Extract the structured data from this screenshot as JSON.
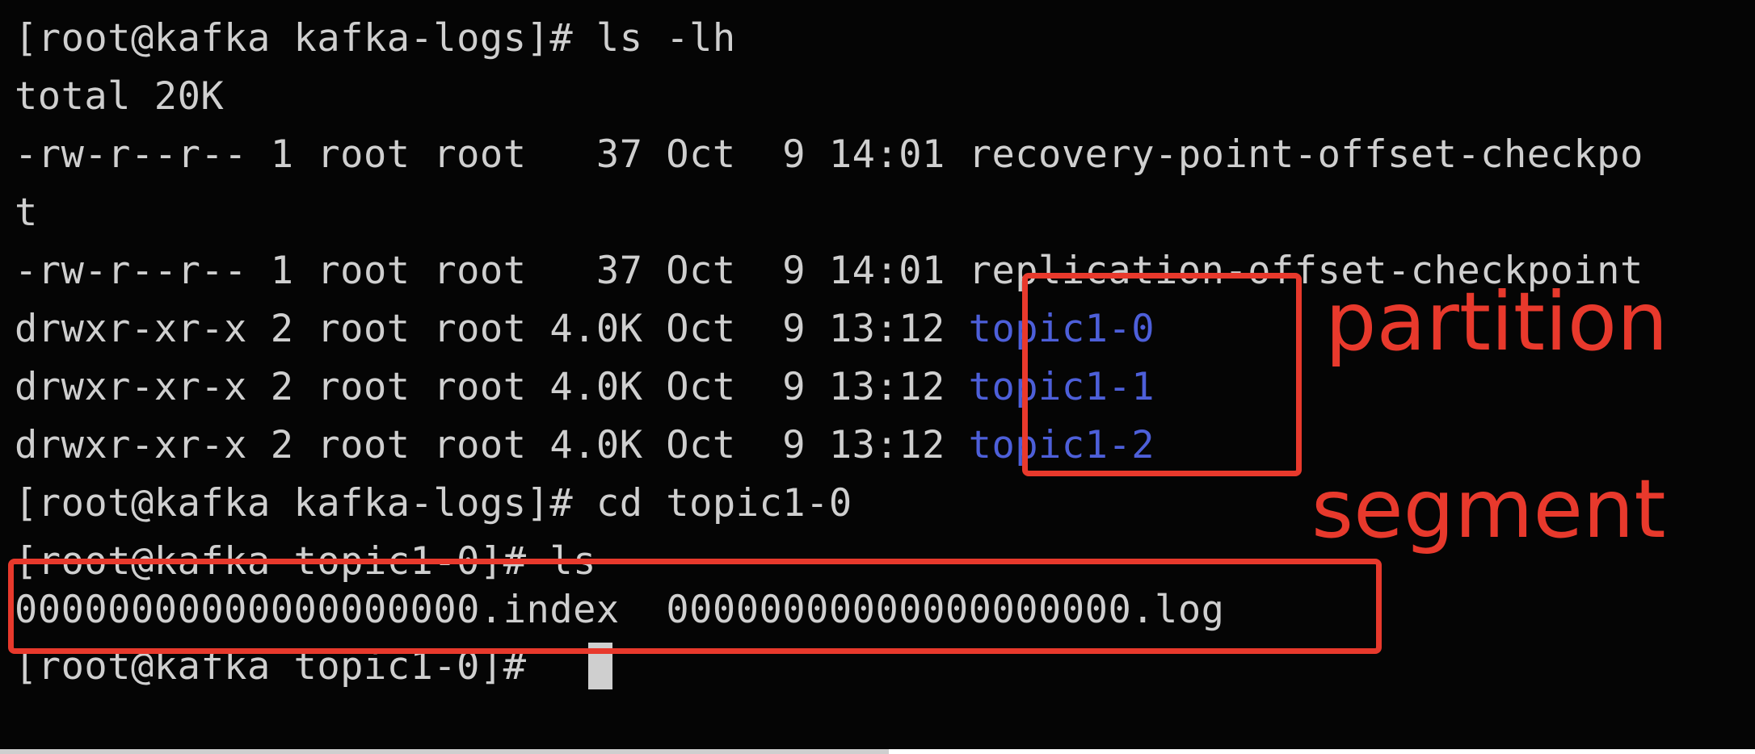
{
  "terminal": {
    "lines": {
      "l1": "[root@kafka kafka-logs]# ls -lh",
      "l2": "total 20K",
      "l3": "-rw-r--r-- 1 root root   37 Oct  9 14:01 recovery-point-offset-checkpo",
      "l4": "t",
      "l5": "-rw-r--r-- 1 root root   37 Oct  9 14:01 replication-offset-checkpoint",
      "l6_prefix": "drwxr-xr-x 2 root root 4.0K Oct  9 13:12 ",
      "l6_dir": "topic1-0",
      "l7_prefix": "drwxr-xr-x 2 root root 4.0K Oct  9 13:12 ",
      "l7_dir": "topic1-1",
      "l8_prefix": "drwxr-xr-x 2 root root 4.0K Oct  9 13:12 ",
      "l8_dir": "topic1-2",
      "l9": "[root@kafka kafka-logs]# cd topic1-0",
      "l10": "[root@kafka topic1-0]# ls",
      "l11_index": "00000000000000000000.index",
      "l11_log": "00000000000000000000.log",
      "l12": "[root@kafka topic1-0]# "
    }
  },
  "annotations": {
    "partition_label": "partition",
    "segment_label": "segment",
    "color": "#e8392c"
  },
  "colors": {
    "background": "#050505",
    "text": "#cfcfcf",
    "directory": "#4d5fd9"
  }
}
